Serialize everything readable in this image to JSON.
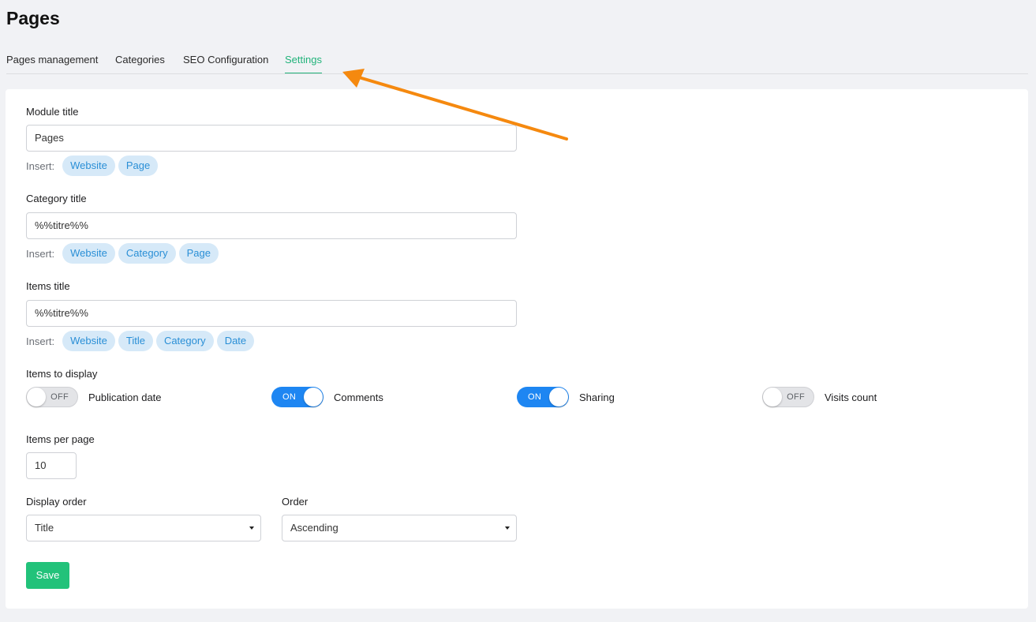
{
  "page": {
    "title": "Pages"
  },
  "tabs": [
    {
      "label": "Pages management"
    },
    {
      "label": "Categories"
    },
    {
      "label": "SEO Configuration"
    },
    {
      "label": "Settings",
      "active": true
    }
  ],
  "form": {
    "insert_label": "Insert:",
    "module_title": {
      "label": "Module title",
      "value": "Pages",
      "chips": [
        "Website",
        "Page"
      ]
    },
    "category_title": {
      "label": "Category title",
      "value": "%%titre%%",
      "chips": [
        "Website",
        "Category",
        "Page"
      ]
    },
    "items_title": {
      "label": "Items title",
      "value": "%%titre%%",
      "chips": [
        "Website",
        "Title",
        "Category",
        "Date"
      ]
    },
    "items_to_display": {
      "label": "Items to display",
      "toggles": [
        {
          "label": "Publication date",
          "state": "OFF"
        },
        {
          "label": "Comments",
          "state": "ON"
        },
        {
          "label": "Sharing",
          "state": "ON"
        },
        {
          "label": "Visits count",
          "state": "OFF"
        }
      ]
    },
    "items_per_page": {
      "label": "Items per page",
      "value": "10"
    },
    "display_order": {
      "label": "Display order",
      "value": "Title"
    },
    "order": {
      "label": "Order",
      "value": "Ascending"
    },
    "save_label": "Save"
  },
  "colors": {
    "accent_green": "#21b37a",
    "toggle_on": "#1e86f2",
    "annotation_arrow": "#f5890f"
  }
}
